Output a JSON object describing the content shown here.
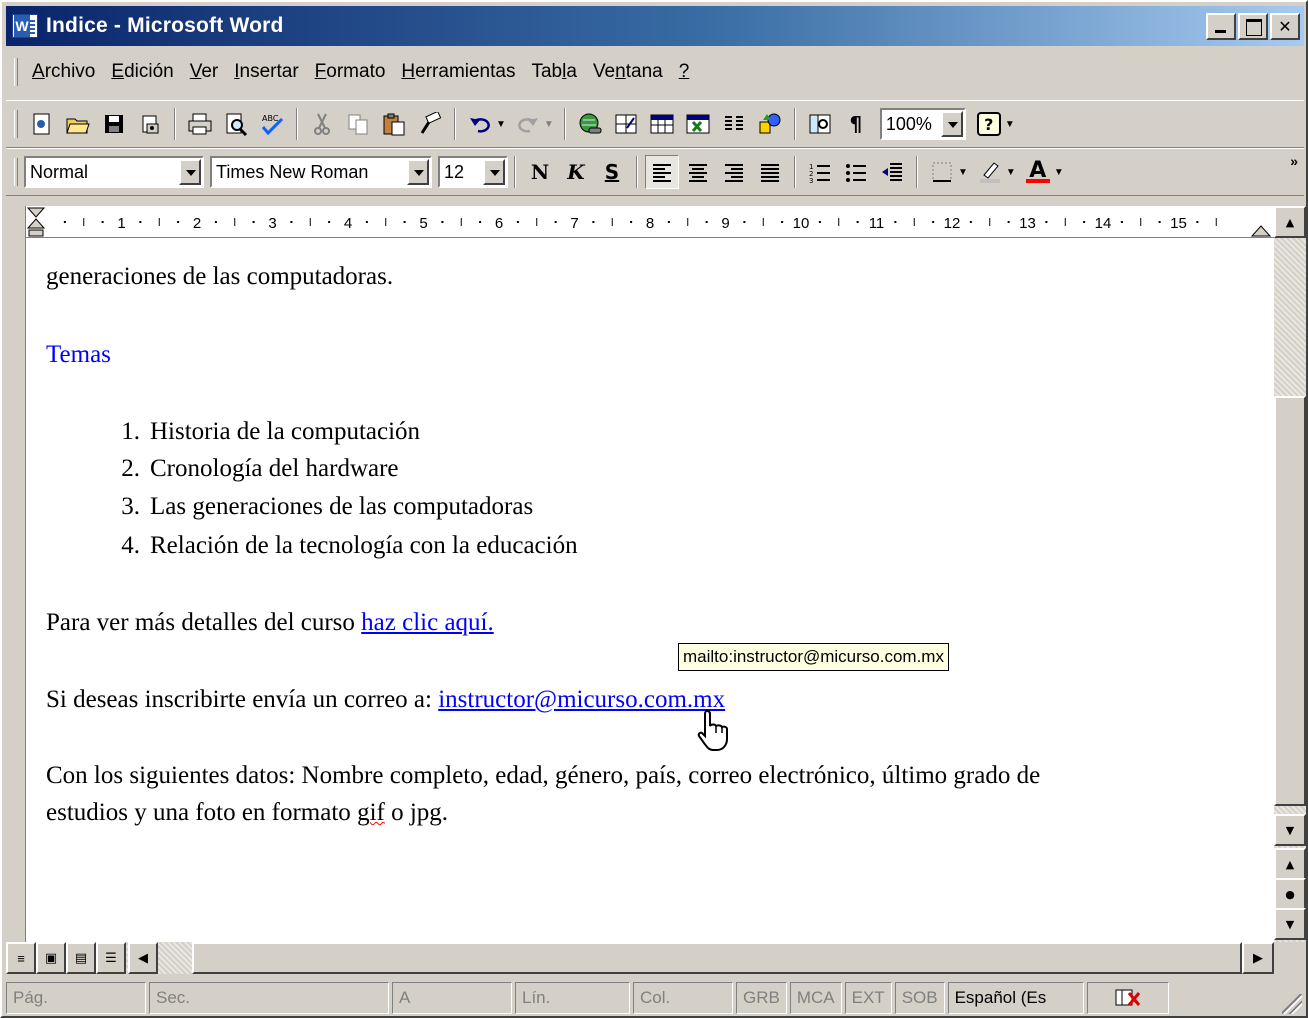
{
  "window": {
    "title": "Indice - Microsoft Word",
    "min_label": "",
    "close_label": "✕"
  },
  "menu": {
    "items": [
      {
        "label": "Archivo"
      },
      {
        "label": "Edición"
      },
      {
        "label": "Ver"
      },
      {
        "label": "Insertar"
      },
      {
        "label": "Formato"
      },
      {
        "label": "Herramientas"
      },
      {
        "label": "Tabla"
      },
      {
        "label": "Ventana"
      },
      {
        "label": "?"
      }
    ]
  },
  "toolbar": {
    "zoom": "100%",
    "pilcrow": "¶",
    "help": "?"
  },
  "format": {
    "style": "Normal",
    "font": "Times New Roman",
    "size": "12",
    "bold": "N",
    "italic": "K",
    "underline": "S",
    "font_color_letter": "A",
    "more": "»"
  },
  "ruler": {
    "numbers": [
      "1",
      "2",
      "3",
      "4",
      "5",
      "6",
      "7",
      "8",
      "9",
      "10",
      "11",
      "12",
      "13",
      "14",
      "15"
    ]
  },
  "document": {
    "line_top": "generaciones de las computadoras.",
    "heading": "Temas",
    "list": [
      {
        "num": "1.",
        "text": "Historia de la computación"
      },
      {
        "num": "2.",
        "text": "Cronología del hardware"
      },
      {
        "num": "3.",
        "text": "Las generaciones de las computadoras"
      },
      {
        "num": "4.",
        "text": "Relación de la tecnología con la educación"
      }
    ],
    "details_prefix": "Para ver más detalles del curso ",
    "details_link": "haz clic aquí.",
    "email_prefix": "Si deseas inscribirte envía un correo a: ",
    "email_link": "instructor@micurso.com.mx",
    "data_line1": "Con los siguientes datos: Nombre completo, edad, género, país, correo electrónico, último grado de",
    "data_line2_a": "estudios y una foto en formato ",
    "data_line2_gif": "gif",
    "data_line2_b": " o jpg."
  },
  "tooltip": {
    "text": "mailto:instructor@micurso.com.mx"
  },
  "statusbar": {
    "page": "Pág.",
    "section": "Sec.",
    "at": "A",
    "line": "Lín.",
    "col": "Col.",
    "grb": "GRB",
    "mca": "MCA",
    "ext": "EXT",
    "sob": "SOB",
    "language": "Español (Es"
  }
}
